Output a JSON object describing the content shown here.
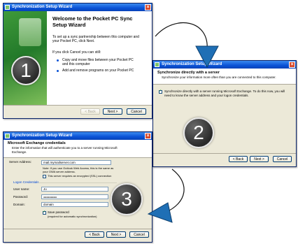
{
  "window1": {
    "title": "Synchronization Setup Wizard",
    "heading": "Welcome to the Pocket PC Sync Setup Wizard",
    "intro": "To set up a sync partnership between this computer and your Pocket PC, click Next.",
    "cancel_hint": "If you click Cancel you can still:",
    "option1": "Copy and move files between your Pocket PC and this computer",
    "option2": "Add and remove programs on your Pocket PC",
    "btn_back": "< Back",
    "btn_next": "Next >",
    "btn_cancel": "Cancel",
    "step": "1"
  },
  "window2": {
    "title": "Synchronization Setup Wizard",
    "heading": "Synchronize directly with a server",
    "subheading": "Synchronize your information more often than you are connected to this computer.",
    "checkbox_label": "Synchronize directly with a server running Microsoft Exchange. To do this now, you will need to know the server address and your logon credentials.",
    "btn_back": "< Back",
    "btn_next": "Next >",
    "btn_cancel": "Cancel",
    "step": "2"
  },
  "window3": {
    "title": "Synchronization Setup Wizard",
    "heading": "Microsoft Exchange credentials",
    "subheading": "Enter the information that will authenticate you to a server running Microsoft Exchange.",
    "server_label": "Server Address:",
    "server_value": "mail.mymailserver.com",
    "note": "Note: If you use Outlook Web Access, this is the same as your OWA server address.",
    "ssl_label": "This server requires an encrypted (SSL) connection",
    "logon_group": "Logon Credentials",
    "user_label": "User name:",
    "user_value": "Jo",
    "password_label": "Password:",
    "password_value": "●●●●●●●●●",
    "domain_label": "Domain:",
    "domain_value": "domain",
    "save_pw_label": "Save password",
    "save_pw_note": "(required for automatic synchronization)",
    "btn_back": "< Back",
    "btn_next": "Next >",
    "btn_cancel": "Cancel",
    "step": "3"
  }
}
